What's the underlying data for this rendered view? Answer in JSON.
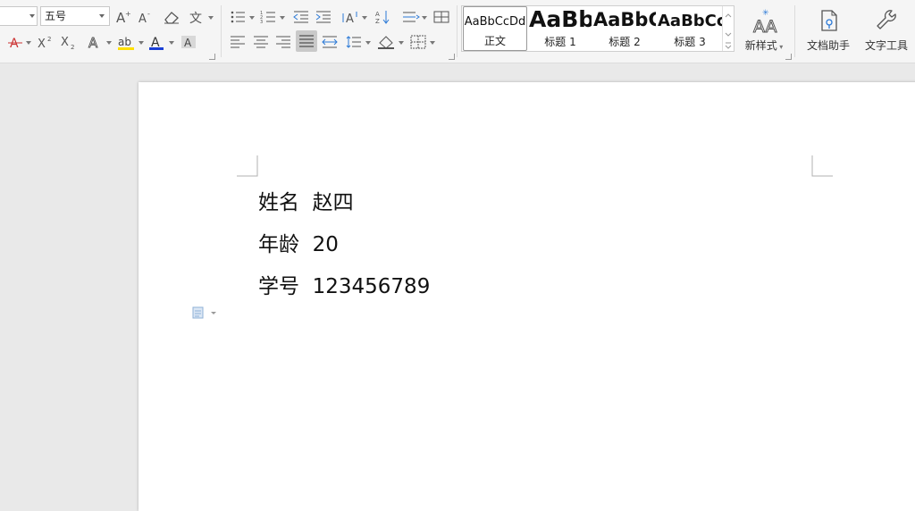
{
  "toolbar": {
    "font_size": "五号",
    "font_name": ""
  },
  "styles": [
    {
      "sample": "AaBbCcDd",
      "name": "正文"
    },
    {
      "sample": "AaBb",
      "name": "标题 1"
    },
    {
      "sample": "AaBbC",
      "name": "标题 2"
    },
    {
      "sample": "AaBbCc",
      "name": "标题 3"
    }
  ],
  "buttons": {
    "new_style": "新样式",
    "doc_assistant": "文档助手",
    "text_tools": "文字工具"
  },
  "document": {
    "lines": [
      {
        "label": "姓名",
        "value": "赵四"
      },
      {
        "label": "年龄",
        "value": "20"
      },
      {
        "label": "学号",
        "value": "123456789"
      }
    ]
  },
  "colors": {
    "highlight": "#ffe000",
    "font_color": "#1a3fd6",
    "accent": "#2b79d6"
  }
}
